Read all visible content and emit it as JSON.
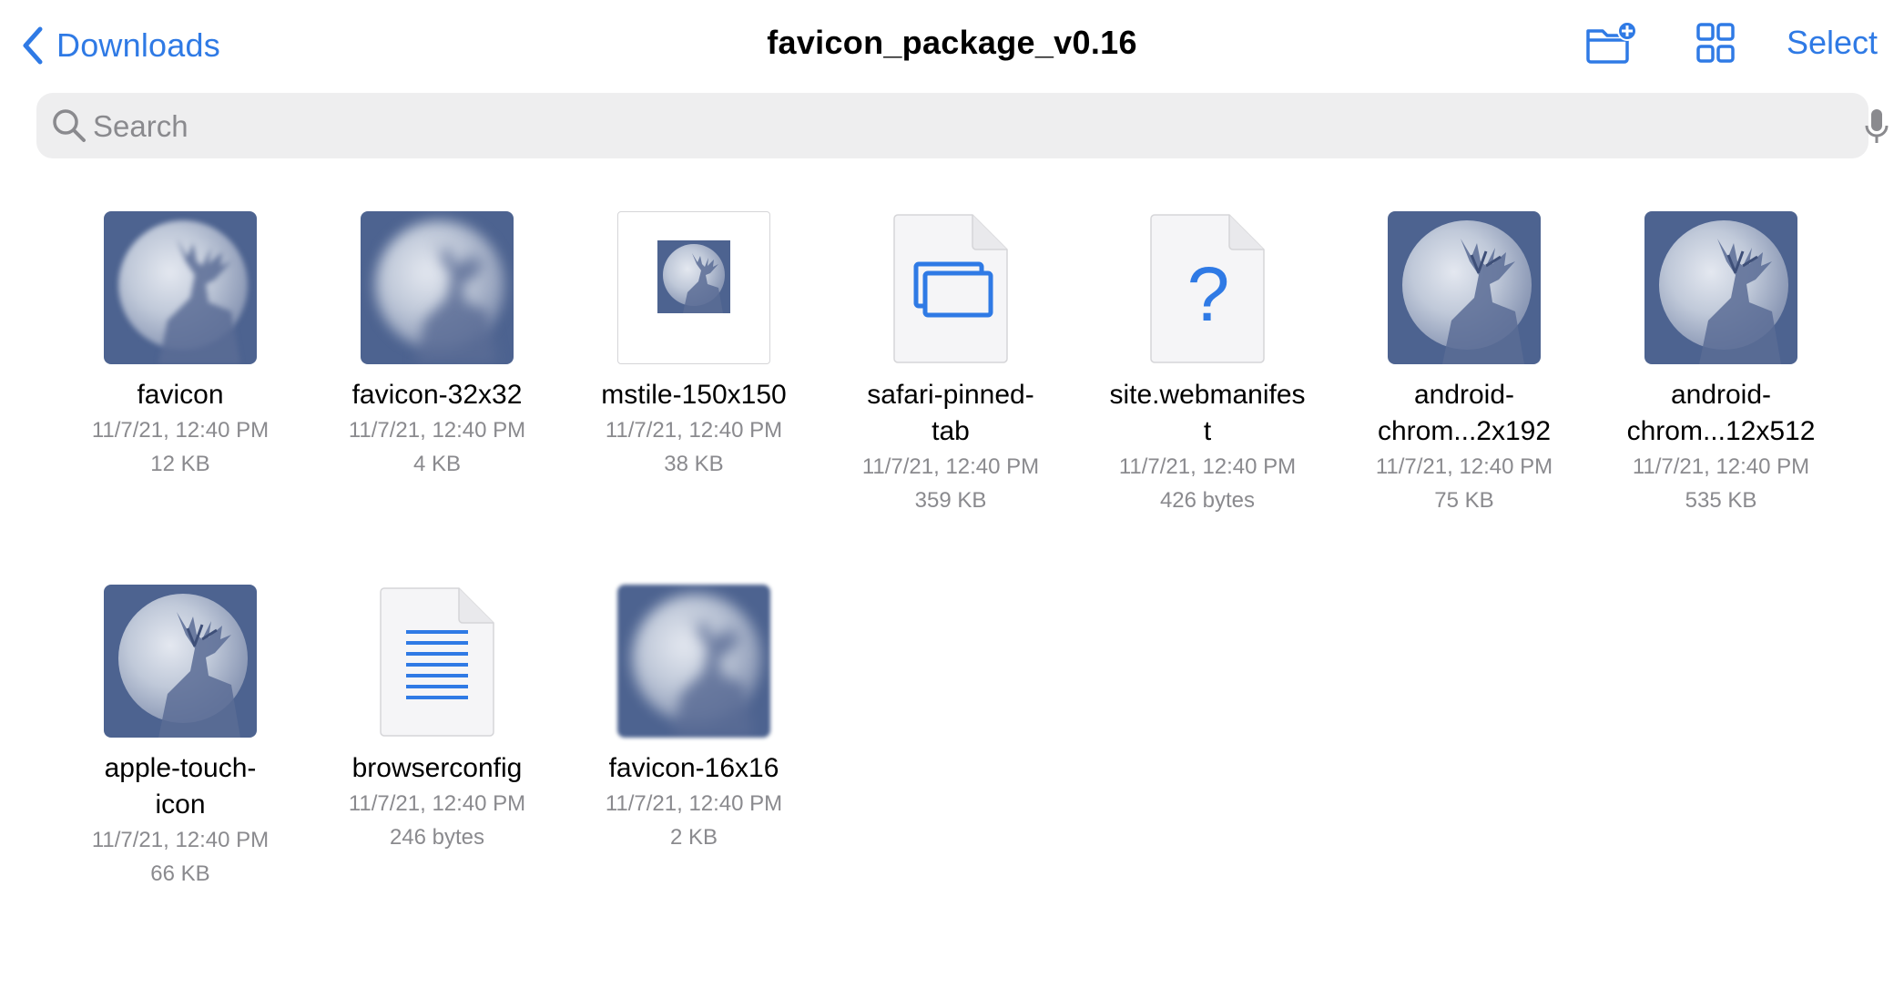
{
  "nav": {
    "back_label": "Downloads",
    "title": "favicon_package_v0.16",
    "select_label": "Select",
    "new_folder_icon": "folder-badge-plus-icon",
    "view_icon": "grid-view-icon",
    "back_icon": "chevron-left-icon"
  },
  "search": {
    "placeholder": "Search",
    "icon": "magnifying-glass-icon",
    "mic_icon": "microphone-icon"
  },
  "colors": {
    "accent": "#2f7ae5",
    "secondary_text": "#8a8a8e",
    "search_bg": "#eeeeef"
  },
  "files": [
    {
      "name_lines": [
        "favicon"
      ],
      "date": "11/7/21, 12:40 PM",
      "size": "12 KB",
      "thumb": "image"
    },
    {
      "name_lines": [
        "favicon-32x32"
      ],
      "date": "11/7/21, 12:40 PM",
      "size": "4 KB",
      "thumb": "image"
    },
    {
      "name_lines": [
        "mstile-150x150"
      ],
      "date": "11/7/21, 12:40 PM",
      "size": "38 KB",
      "thumb": "image"
    },
    {
      "name_lines": [
        "safari-pinned-",
        "tab"
      ],
      "date": "11/7/21, 12:40 PM",
      "size": "359 KB",
      "thumb": "svg-document-icon"
    },
    {
      "name_lines": [
        "site.webmanifes",
        "t"
      ],
      "date": "11/7/21, 12:40 PM",
      "size": "426 bytes",
      "thumb": "unknown-document-icon"
    },
    {
      "name_lines": [
        "android-",
        "chrom...2x192"
      ],
      "date": "11/7/21, 12:40 PM",
      "size": "75 KB",
      "thumb": "image"
    },
    {
      "name_lines": [
        "android-",
        "chrom...12x512"
      ],
      "date": "11/7/21, 12:40 PM",
      "size": "535 KB",
      "thumb": "image"
    },
    {
      "name_lines": [
        "apple-touch-",
        "icon"
      ],
      "date": "11/7/21, 12:40 PM",
      "size": "66 KB",
      "thumb": "image"
    },
    {
      "name_lines": [
        "browserconfig"
      ],
      "date": "11/7/21, 12:40 PM",
      "size": "246 bytes",
      "thumb": "text-document-icon"
    },
    {
      "name_lines": [
        "favicon-16x16"
      ],
      "date": "11/7/21, 12:40 PM",
      "size": "2 KB",
      "thumb": "image"
    }
  ]
}
